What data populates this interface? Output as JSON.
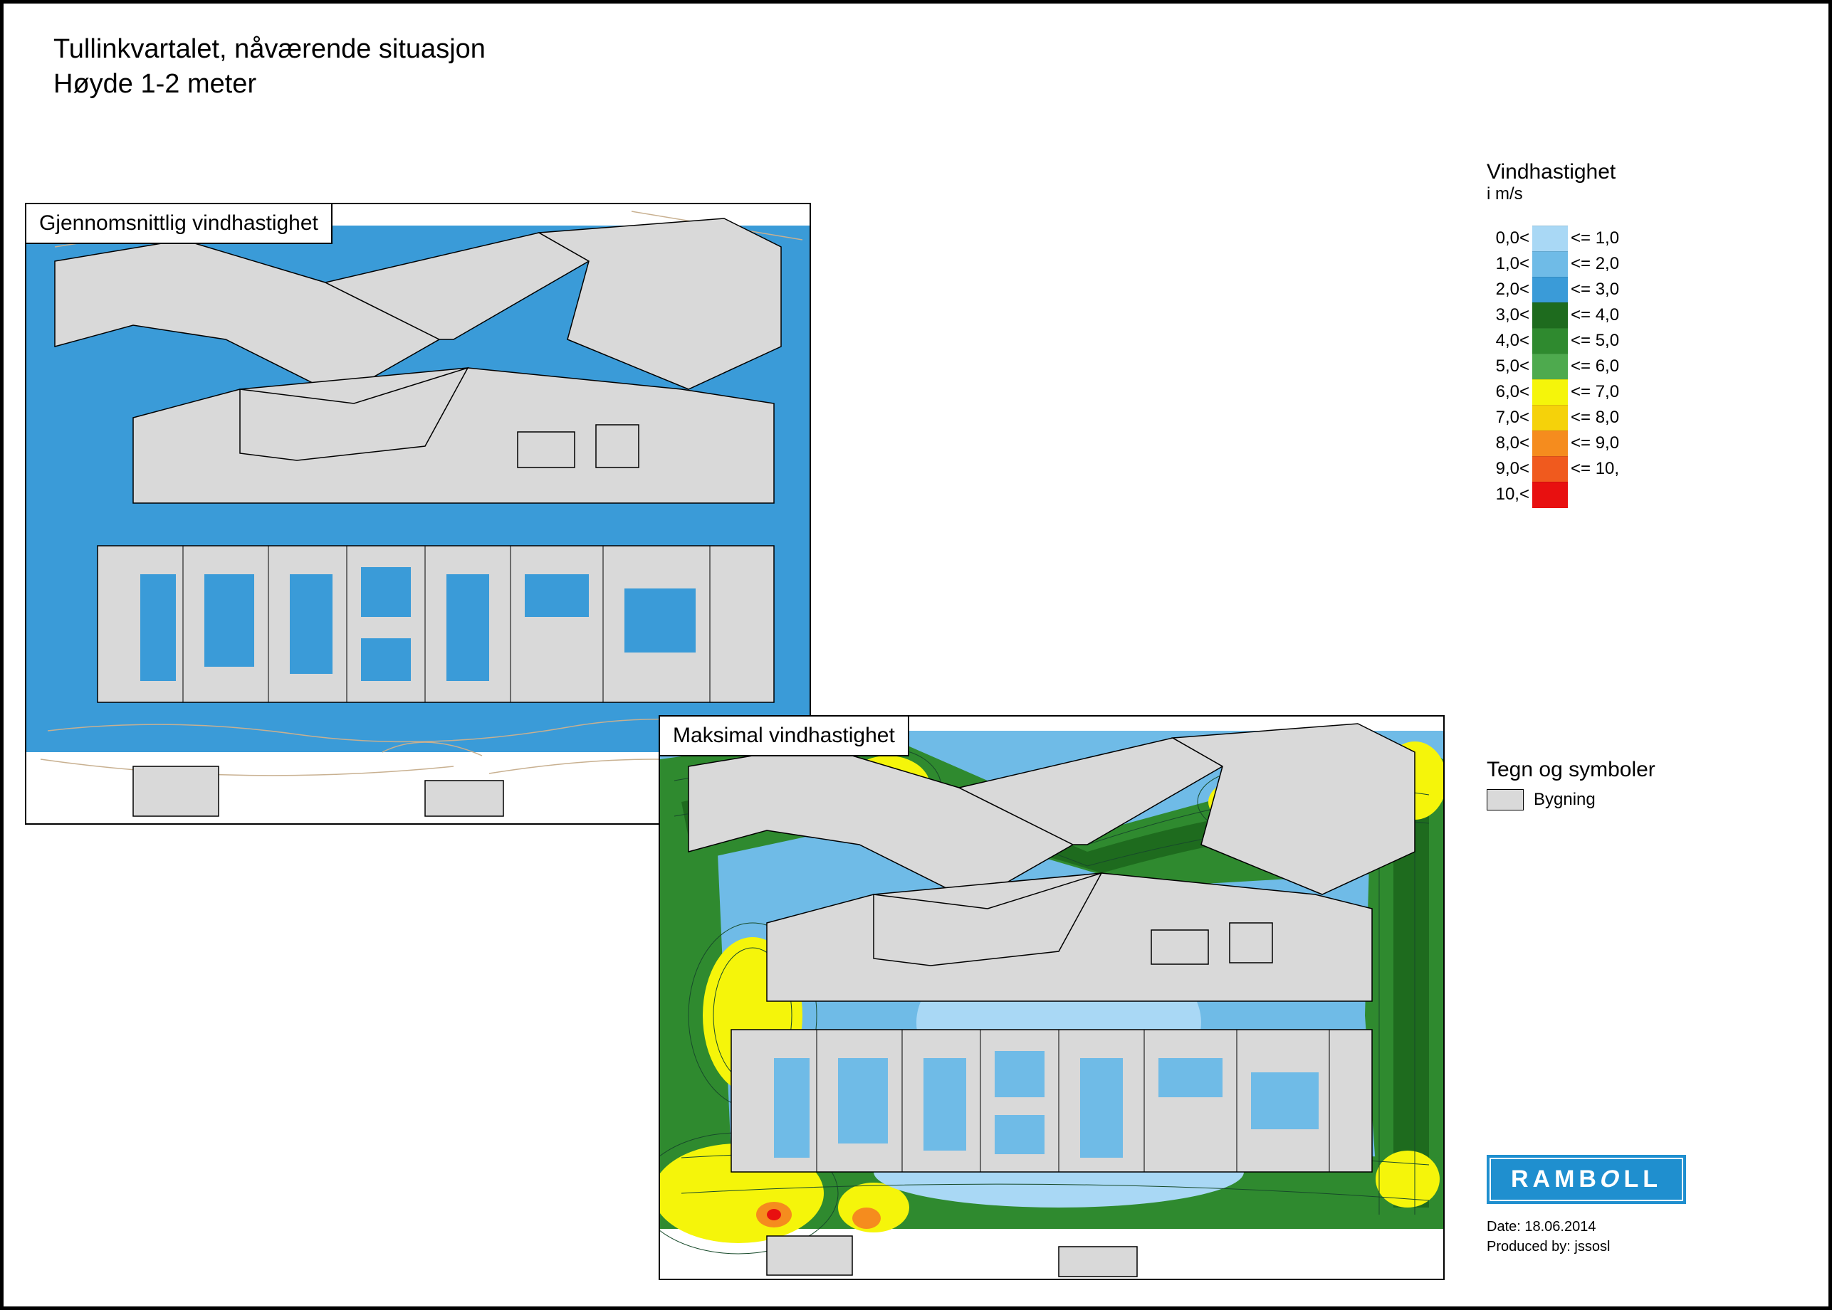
{
  "title": {
    "line1": "Tullinkvartalet, nåværende situasjon",
    "line2": "Høyde 1-2 meter"
  },
  "maps": {
    "avg": {
      "label": "Gjennomsnittlig vindhastighet"
    },
    "max": {
      "label": "Maksimal vindhastighet"
    }
  },
  "legend": {
    "title": "Vindhastighet",
    "unit": "i m/s",
    "rows": [
      {
        "low": "0,0<",
        "high": "<= 1,0",
        "color": "#a9d8f5"
      },
      {
        "low": "1,0<",
        "high": "<= 2,0",
        "color": "#6fbbe7"
      },
      {
        "low": "2,0<",
        "high": "<= 3,0",
        "color": "#3a9bd8"
      },
      {
        "low": "3,0<",
        "high": "<= 4,0",
        "color": "#1e6b1e"
      },
      {
        "low": "4,0<",
        "high": "<= 5,0",
        "color": "#2f8a2f"
      },
      {
        "low": "5,0<",
        "high": "<= 6,0",
        "color": "#4eaa4e"
      },
      {
        "low": "6,0<",
        "high": "<= 7,0",
        "color": "#f5f50a"
      },
      {
        "low": "7,0<",
        "high": "<= 8,0",
        "color": "#f5d20a"
      },
      {
        "low": "8,0<",
        "high": "<= 9,0",
        "color": "#f58c1e"
      },
      {
        "low": "9,0<",
        "high": "<= 10,",
        "color": "#f05a1e"
      },
      {
        "low": "10,<",
        "high": "",
        "color": "#e81010"
      }
    ]
  },
  "symbols": {
    "title": "Tegn og symboler",
    "items": [
      {
        "label": "Bygning",
        "swatch": "#d9d9d9"
      }
    ]
  },
  "logo": {
    "text": "RAMBOLL"
  },
  "meta": {
    "date_label": "Date:",
    "date": "18.06.2014",
    "producer_label": "Produced by:",
    "producer": "jssosl"
  },
  "chart_data": {
    "type": "heatmap",
    "title": "Wind speed simulation — Tullinkvartalet, current situation, height 1–2 m",
    "unit": "m/s",
    "panels": [
      {
        "name": "Gjennomsnittlig vindhastighet",
        "description": "Average wind speed",
        "value_range_observed": [
          0.0,
          3.0
        ],
        "dominant_band": "1,0–3,0 m/s (blue)",
        "notes": "Uniformly low average wind speed across courtyards and surrounding streets; no green/yellow zones visible."
      },
      {
        "name": "Maksimal vindhastighet",
        "description": "Maximum wind speed",
        "value_range_observed": [
          0.0,
          9.0
        ],
        "zones": [
          {
            "area": "interior courtyards",
            "band": "1–3 m/s",
            "color": "blue"
          },
          {
            "area": "street canyons N, E, S perimeter",
            "band": "3–6 m/s",
            "color": "green"
          },
          {
            "area": "NW diagonal street, SW corner, SE corner, NE junction",
            "band": "6–8 m/s",
            "color": "yellow"
          },
          {
            "area": "small spots SW corner near building gaps",
            "band": "8–9 m/s",
            "color": "orange"
          },
          {
            "area": "tiny spot SW corner",
            "band": ">9 m/s",
            "color": "red"
          }
        ]
      }
    ],
    "color_scale": [
      {
        "min": 0.0,
        "max": 1.0,
        "color": "#a9d8f5"
      },
      {
        "min": 1.0,
        "max": 2.0,
        "color": "#6fbbe7"
      },
      {
        "min": 2.0,
        "max": 3.0,
        "color": "#3a9bd8"
      },
      {
        "min": 3.0,
        "max": 4.0,
        "color": "#1e6b1e"
      },
      {
        "min": 4.0,
        "max": 5.0,
        "color": "#2f8a2f"
      },
      {
        "min": 5.0,
        "max": 6.0,
        "color": "#4eaa4e"
      },
      {
        "min": 6.0,
        "max": 7.0,
        "color": "#f5f50a"
      },
      {
        "min": 7.0,
        "max": 8.0,
        "color": "#f5d20a"
      },
      {
        "min": 8.0,
        "max": 9.0,
        "color": "#f58c1e"
      },
      {
        "min": 9.0,
        "max": 10.0,
        "color": "#f05a1e"
      },
      {
        "min": 10.0,
        "max": null,
        "color": "#e81010"
      }
    ]
  }
}
